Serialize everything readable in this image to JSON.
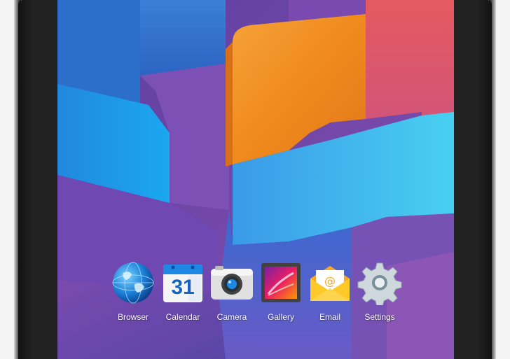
{
  "dock": {
    "apps": [
      {
        "label": "Browser",
        "icon": "globe-icon"
      },
      {
        "label": "Calendar",
        "icon": "calendar-icon",
        "day": "31"
      },
      {
        "label": "Camera",
        "icon": "camera-icon"
      },
      {
        "label": "Gallery",
        "icon": "gallery-icon"
      },
      {
        "label": "Email",
        "icon": "email-icon"
      },
      {
        "label": "Settings",
        "icon": "gear-icon"
      }
    ]
  },
  "colors": {
    "wallpaper_blue": "#2f8fe0",
    "wallpaper_orange": "#f08a1c",
    "wallpaper_cyan": "#3cc2ea",
    "wallpaper_purple": "#7a4aa8",
    "bezel": "#1a1a1a"
  }
}
